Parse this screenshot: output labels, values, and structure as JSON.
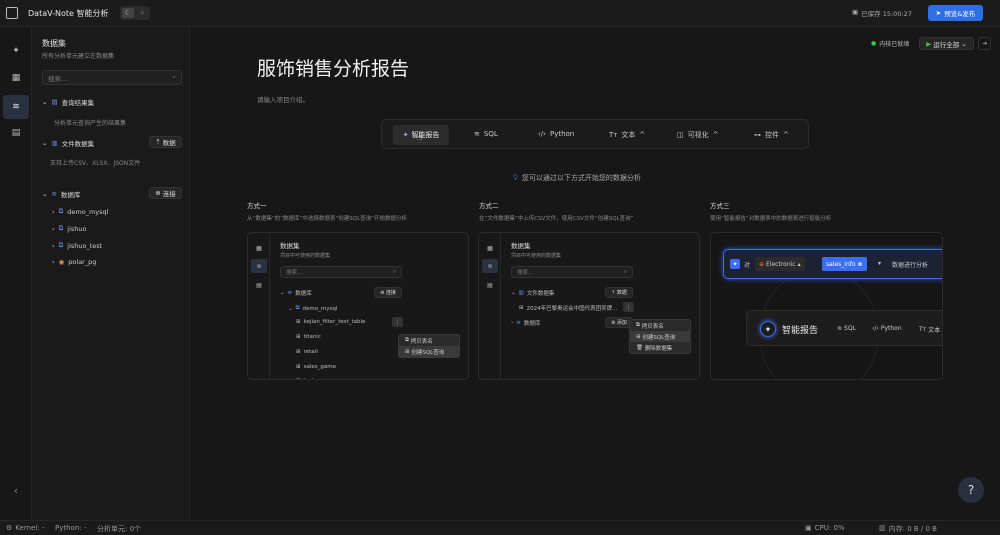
{
  "app": {
    "title": "DataV-Note 智能分析",
    "saved": "已保存 15:00:27",
    "publish": "预览&发布"
  },
  "sidebar": {
    "title": "数据集",
    "subtitle": "所有分析单元建立在数据集",
    "search_placeholder": "搜索...",
    "sections": [
      {
        "label": "查询结果集",
        "desc": "分析单元查询产生的结果集"
      },
      {
        "label": "文件数据集",
        "button": "数据",
        "desc": "支持上传CSV、XLSX、JSON文件"
      },
      {
        "label": "数据库",
        "button": "连接"
      }
    ],
    "dbs": [
      "demo_mysql",
      "jishuo",
      "jishuo_test",
      "polar_pg"
    ]
  },
  "main": {
    "kernel": "内核已就绪",
    "run_all": "运行全部",
    "title": "服饰销售分析报告",
    "intro": "请输入项目介绍。",
    "toolbar": [
      "智能报告",
      "SQL",
      "Python",
      "文本",
      "可视化",
      "控件"
    ],
    "hint": "您可以通过以下方式开始您的数据分析",
    "methods": [
      {
        "title": "方式一",
        "desc": "从“数据集”的“数据库”中选择数据表“创建SQL查询”开始数据分析"
      },
      {
        "title": "方式二",
        "desc": "在“文件数据集”中上传CSV文件，使用CSV文件“创建SQL查询”"
      },
      {
        "title": "方式三",
        "desc": "使用“智能报告”对数据表中的数据表进行智能分析"
      }
    ],
    "card1": {
      "title": "数据集",
      "sub": "项目中可使用的数据集",
      "search": "搜索...",
      "db": "数据库",
      "connect": "连接",
      "conn": "demo_mysql",
      "tables": [
        "kejian_filter_test_table",
        "titanic",
        "retail",
        "sales_game",
        "test"
      ],
      "menu": [
        "拷贝表名",
        "创建SQL查询"
      ]
    },
    "card2": {
      "title": "数据集",
      "sub": "项目中可使用的数据集",
      "search": "搜索...",
      "fileset": "文件数据集",
      "data": "数据",
      "file": "2024年巴黎奥运会中国代表团奖牌...",
      "db": "数据库",
      "add": "添加",
      "menu": [
        "拷贝表名",
        "创建SQL查询",
        "删除数据集"
      ]
    },
    "card3": {
      "to": "对",
      "cat": "Electronic",
      "table": "sales_info",
      "action": "数据进行分析",
      "ai": "智能报告",
      "sql": "SQL",
      "py": "Python",
      "txt": "文本"
    }
  },
  "status": {
    "kernel": "Kernel: -",
    "python": "Python: -",
    "cells": "分析单元: 0个",
    "cpu": "CPU: 0%",
    "mem": "内存: 0 B / 0 B"
  }
}
